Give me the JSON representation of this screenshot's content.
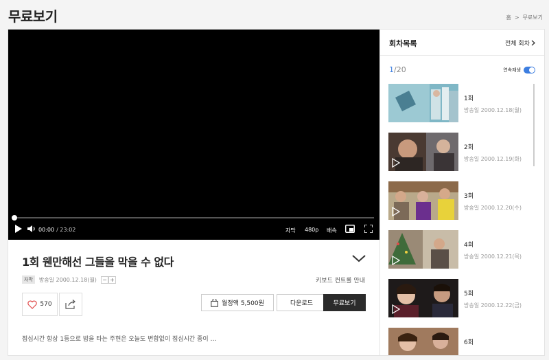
{
  "page": {
    "title": "무료보기"
  },
  "breadcrumb": {
    "home": "홈",
    "sep": ">",
    "current": "무료보기"
  },
  "player": {
    "progress": 0,
    "time_current": "00:00",
    "time_total": "/ 23:02",
    "subtitle_label": "자막",
    "quality_label": "480p",
    "speed_label": "배속",
    "icons": [
      "play-icon",
      "volume-icon",
      "pip-icon",
      "fullscreen-icon"
    ]
  },
  "episode": {
    "title": "1회 웬만해선 그들을 막을 수 없다",
    "badge": "자막",
    "air_date": "방송일 2000.12.18(월)",
    "size_minus": "−",
    "size_plus": "+",
    "keyboard_guide": "키보드 컨트롤 안내",
    "likes": "570",
    "monthly_label": "월정액 5,500원",
    "download_label": "다운로드",
    "free_label": "무료보기",
    "synopsis": "점심시간 항상 1등으로 밥을 타는 주현은 오늘도 변함없이 점심시간 종이 …"
  },
  "sidebar": {
    "title": "회차목록",
    "all_label": "전체 회차",
    "count_current": "1",
    "count_total": "/20",
    "autoplay_label": "연속재생",
    "autoplay_on": true,
    "items": [
      {
        "no": "1회",
        "date": "방송일 2000.12.18(월)"
      },
      {
        "no": "2회",
        "date": "방송일 2000.12.19(화)"
      },
      {
        "no": "3회",
        "date": "방송일 2000.12.20(수)"
      },
      {
        "no": "4회",
        "date": "방송일 2000.12.21(목)"
      },
      {
        "no": "5회",
        "date": "방송일 2000.12.22(금)"
      },
      {
        "no": "6회",
        "date": ""
      }
    ]
  },
  "colors": {
    "accent": "#3d7ee0",
    "dark_button": "#2b2b2b",
    "heart": "#e04a4a"
  }
}
